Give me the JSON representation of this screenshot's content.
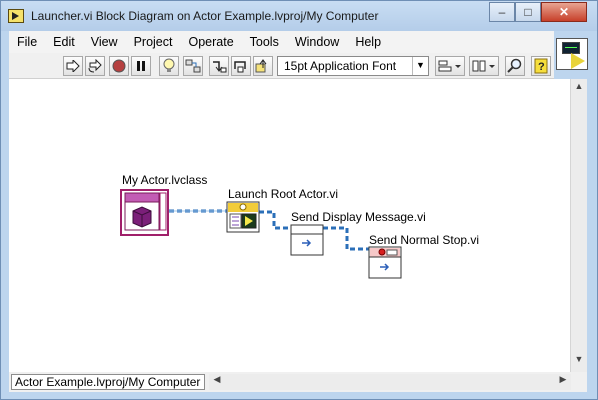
{
  "window": {
    "title": "Launcher.vi Block Diagram on Actor Example.lvproj/My Computer",
    "controls": {
      "minimize": "–",
      "maximize": "□",
      "close": "✕"
    }
  },
  "menubar": {
    "items": [
      "File",
      "Edit",
      "View",
      "Project",
      "Operate",
      "Tools",
      "Window",
      "Help"
    ]
  },
  "toolbar": {
    "buttons": [
      "run-arrow-icon",
      "run-continuously-icon",
      "abort-icon",
      "pause-icon",
      "highlight-execution-icon",
      "retain-wire-values-icon",
      "step-into-icon",
      "step-over-icon",
      "step-out-icon",
      "warning-icon",
      "align-objects-icon",
      "distribute-objects-icon",
      "reorder-icon",
      "search-icon",
      "help-icon"
    ],
    "font": {
      "selected": "15pt Application Font",
      "arrow": "▼"
    }
  },
  "diagram": {
    "nodes": {
      "actor_class": {
        "label": "My Actor.lvclass",
        "border_color": "#a01f6a",
        "fill_color": "#d47bc2"
      },
      "launch_root": {
        "label": "Launch Root Actor.vi",
        "accent": "#f2cc3a"
      },
      "send_display": {
        "label": "Send Display Message.vi"
      },
      "send_stop": {
        "label": "Send Normal Stop.vi"
      }
    },
    "wire_color": "#2b6fb8"
  },
  "statusbar": {
    "path": "Actor Example.lvproj/My Computer"
  },
  "scroll": {
    "up": "▲",
    "down": "▼",
    "left": "◀",
    "right": "▶"
  }
}
